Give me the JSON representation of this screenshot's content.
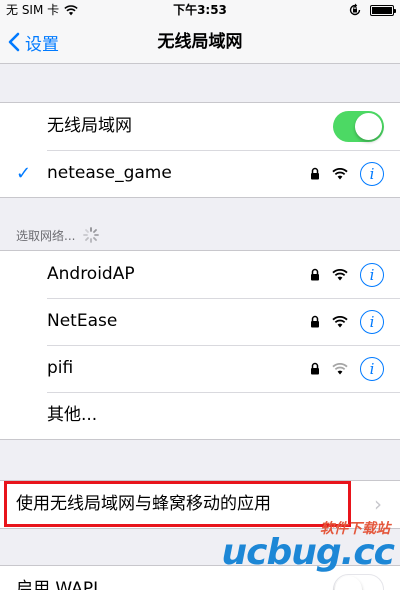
{
  "status_bar": {
    "carrier": "无 SIM 卡",
    "time": "下午3:53",
    "battery_level": 1.0
  },
  "nav": {
    "back_label": "设置",
    "title": "无线局域网"
  },
  "wlan": {
    "toggle_label": "无线局域网",
    "toggle_on": true,
    "connected_network": "netease_game"
  },
  "section_header": "选取网络...",
  "networks": [
    {
      "name": "AndroidAP",
      "locked": true
    },
    {
      "name": "NetEase",
      "locked": true
    },
    {
      "name": "pifi",
      "locked": true
    }
  ],
  "other_label": "其他...",
  "apps_row_label": "使用无线局域网与蜂窝移动的应用",
  "wapi": {
    "label": "启用 WAPI",
    "toggle_on": false
  },
  "watermark": {
    "small": "软件下载站",
    "big": "ucbug.cc"
  },
  "colors": {
    "accent": "#007aff",
    "toggle_on": "#4cd964",
    "highlight": "#e8141b"
  },
  "icons": {
    "info": "i"
  }
}
